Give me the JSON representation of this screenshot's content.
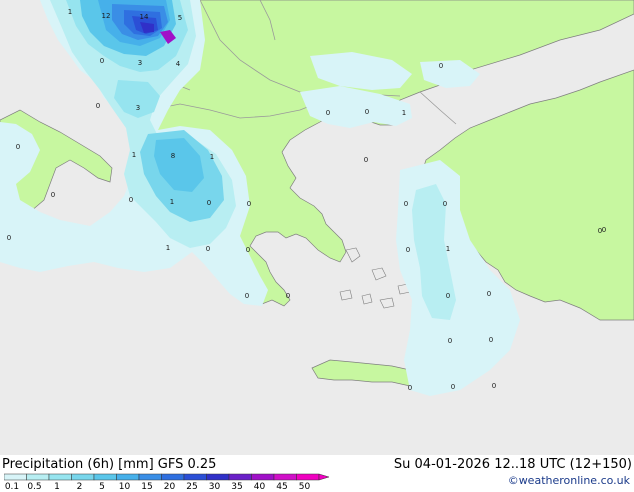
{
  "map": {
    "colors": {
      "sea": "#ebebeb",
      "land_dry": "#c7f7a0",
      "border": "#9a9a9a",
      "coast": "#7f7f7f"
    },
    "precip_labels": [
      {
        "text": "12",
        "id": "12-north"
      },
      {
        "text": "14",
        "id": "14-north"
      },
      {
        "text": "5",
        "id": "5-north"
      },
      {
        "text": "1",
        "id": "1-northwest"
      },
      {
        "text": "0",
        "id": "0-west"
      },
      {
        "text": "3",
        "id": "3-a"
      },
      {
        "text": "4",
        "id": "4-a"
      },
      {
        "text": "0",
        "id": "0-b"
      },
      {
        "text": "3",
        "id": "3-b"
      },
      {
        "text": "0",
        "id": "0-italy"
      },
      {
        "text": "1",
        "id": "1-albania"
      },
      {
        "text": "8",
        "id": "8-epirus"
      },
      {
        "text": "1",
        "id": "1-epirus-e"
      },
      {
        "text": "0",
        "id": "0-c"
      },
      {
        "text": "1",
        "id": "1-c"
      },
      {
        "text": "0",
        "id": "0-d"
      },
      {
        "text": "0",
        "id": "0-e"
      },
      {
        "text": "1",
        "id": "1-f"
      },
      {
        "text": "0",
        "id": "0-g"
      },
      {
        "text": "0",
        "id": "0-h"
      },
      {
        "text": "0",
        "id": "0-i"
      },
      {
        "text": "0",
        "id": "0-j"
      },
      {
        "text": "0",
        "id": "0-k"
      },
      {
        "text": "0",
        "id": "0-l"
      },
      {
        "text": "0",
        "id": "0-m"
      },
      {
        "text": "1",
        "id": "1-n"
      },
      {
        "text": "0",
        "id": "0-o"
      },
      {
        "text": "0",
        "id": "0-p"
      },
      {
        "text": "0",
        "id": "0-q"
      },
      {
        "text": "0",
        "id": "0-r"
      },
      {
        "text": "0",
        "id": "0-s"
      },
      {
        "text": "0",
        "id": "0-t"
      },
      {
        "text": "0",
        "id": "0-u"
      },
      {
        "text": "0",
        "id": "0-v"
      },
      {
        "text": "0",
        "id": "0-w"
      },
      {
        "text": "0",
        "id": "0-x"
      },
      {
        "text": "0",
        "id": "0-y"
      },
      {
        "text": "0",
        "id": "0-z"
      },
      {
        "text": "1",
        "id": "1-dodecanese"
      },
      {
        "text": "0",
        "id": "0-rhodes"
      },
      {
        "text": "0",
        "id": "0-east"
      },
      {
        "text": "0",
        "id": "0-crete"
      }
    ]
  },
  "footer": {
    "title": "Precipitation (6h) [mm] GFS 0.25",
    "validity": "Su 04-01-2026 12..18 UTC (12+150)",
    "credit": "©weatheronline.co.uk",
    "scale": {
      "ticks": [
        "0.1",
        "0.5",
        "1",
        "2",
        "5",
        "10",
        "15",
        "20",
        "25",
        "30",
        "35",
        "40",
        "45",
        "50"
      ],
      "colors": [
        "#d8f4f8",
        "#b8eef2",
        "#96e4ef",
        "#78d6ec",
        "#5ac6ea",
        "#46b0ea",
        "#3a8ee6",
        "#2f6fe0",
        "#2b4fd6",
        "#3030c8",
        "#6a20c8",
        "#a010c8",
        "#d010c8",
        "#f000c0"
      ]
    }
  }
}
